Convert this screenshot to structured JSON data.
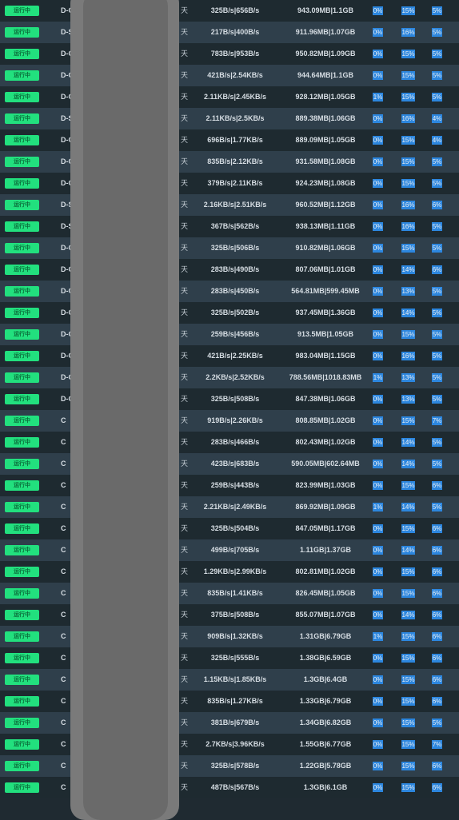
{
  "status_label": "运行中",
  "day_label": "天",
  "colors": {
    "status_green": "#22e07e",
    "percent_blue": "#2c86de",
    "row_dark": "#1e2a30",
    "row_light": "#2f3f4b"
  },
  "rows": [
    {
      "name": "D-C",
      "speed": "325B/s|656B/s",
      "traffic": "943.09MB|1.1GB",
      "cpu": "0%",
      "mem": "15%",
      "disk": "5%"
    },
    {
      "name": "D-S",
      "speed": "217B/s|400B/s",
      "traffic": "911.96MB|1.07GB",
      "cpu": "0%",
      "mem": "16%",
      "disk": "5%"
    },
    {
      "name": "D-C",
      "speed": "783B/s|953B/s",
      "traffic": "950.82MB|1.09GB",
      "cpu": "0%",
      "mem": "15%",
      "disk": "5%"
    },
    {
      "name": "D-C",
      "speed": "421B/s|2.54KB/s",
      "traffic": "944.64MB|1.1GB",
      "cpu": "0%",
      "mem": "15%",
      "disk": "5%"
    },
    {
      "name": "D-C",
      "speed": "2.11KB/s|2.45KB/s",
      "traffic": "928.12MB|1.05GB",
      "cpu": "1%",
      "mem": "15%",
      "disk": "5%"
    },
    {
      "name": "D-S",
      "speed": "2.11KB/s|2.5KB/s",
      "traffic": "889.38MB|1.06GB",
      "cpu": "0%",
      "mem": "16%",
      "disk": "4%"
    },
    {
      "name": "D-C",
      "speed": "696B/s|1.77KB/s",
      "traffic": "889.09MB|1.05GB",
      "cpu": "0%",
      "mem": "15%",
      "disk": "4%"
    },
    {
      "name": "D-C",
      "speed": "835B/s|2.12KB/s",
      "traffic": "931.58MB|1.08GB",
      "cpu": "0%",
      "mem": "15%",
      "disk": "5%"
    },
    {
      "name": "D-C",
      "speed": "379B/s|2.11KB/s",
      "traffic": "924.23MB|1.08GB",
      "cpu": "0%",
      "mem": "15%",
      "disk": "5%"
    },
    {
      "name": "D-S",
      "speed": "2.16KB/s|2.51KB/s",
      "traffic": "960.52MB|1.12GB",
      "cpu": "0%",
      "mem": "16%",
      "disk": "6%"
    },
    {
      "name": "D-S",
      "speed": "367B/s|562B/s",
      "traffic": "938.13MB|1.11GB",
      "cpu": "0%",
      "mem": "16%",
      "disk": "5%"
    },
    {
      "name": "D-C",
      "speed": "325B/s|506B/s",
      "traffic": "910.82MB|1.06GB",
      "cpu": "0%",
      "mem": "15%",
      "disk": "5%"
    },
    {
      "name": "D-C",
      "speed": "283B/s|490B/s",
      "traffic": "807.06MB|1.01GB",
      "cpu": "0%",
      "mem": "14%",
      "disk": "6%"
    },
    {
      "name": "D-C",
      "speed": "283B/s|450B/s",
      "traffic": "564.81MB|599.45MB",
      "cpu": "0%",
      "mem": "13%",
      "disk": "5%"
    },
    {
      "name": "D-C",
      "speed": "325B/s|502B/s",
      "traffic": "937.45MB|1.36GB",
      "cpu": "0%",
      "mem": "14%",
      "disk": "5%"
    },
    {
      "name": "D-C",
      "speed": "259B/s|456B/s",
      "traffic": "913.5MB|1.05GB",
      "cpu": "0%",
      "mem": "15%",
      "disk": "5%"
    },
    {
      "name": "D-C",
      "speed": "421B/s|2.25KB/s",
      "traffic": "983.04MB|1.15GB",
      "cpu": "0%",
      "mem": "16%",
      "disk": "5%"
    },
    {
      "name": "D-C",
      "speed": "2.2KB/s|2.52KB/s",
      "traffic": "788.56MB|1018.83MB",
      "cpu": "1%",
      "mem": "13%",
      "disk": "5%"
    },
    {
      "name": "D-C",
      "speed": "325B/s|508B/s",
      "traffic": "847.38MB|1.06GB",
      "cpu": "0%",
      "mem": "13%",
      "disk": "5%"
    },
    {
      "name": "C",
      "speed": "919B/s|2.26KB/s",
      "traffic": "808.85MB|1.02GB",
      "cpu": "0%",
      "mem": "15%",
      "disk": "7%"
    },
    {
      "name": "C",
      "speed": "283B/s|466B/s",
      "traffic": "802.43MB|1.02GB",
      "cpu": "0%",
      "mem": "14%",
      "disk": "5%"
    },
    {
      "name": "C",
      "speed": "423B/s|683B/s",
      "traffic": "590.05MB|602.64MB",
      "cpu": "0%",
      "mem": "14%",
      "disk": "5%"
    },
    {
      "name": "C",
      "speed": "259B/s|443B/s",
      "traffic": "823.99MB|1.03GB",
      "cpu": "0%",
      "mem": "15%",
      "disk": "6%"
    },
    {
      "name": "C",
      "speed": "2.21KB/s|2.49KB/s",
      "traffic": "869.92MB|1.09GB",
      "cpu": "1%",
      "mem": "14%",
      "disk": "5%"
    },
    {
      "name": "C",
      "speed": "325B/s|504B/s",
      "traffic": "847.05MB|1.17GB",
      "cpu": "0%",
      "mem": "15%",
      "disk": "6%"
    },
    {
      "name": "C",
      "speed": "499B/s|705B/s",
      "traffic": "1.11GB|1.37GB",
      "cpu": "0%",
      "mem": "14%",
      "disk": "6%"
    },
    {
      "name": "C",
      "speed": "1.29KB/s|2.99KB/s",
      "traffic": "802.81MB|1.02GB",
      "cpu": "0%",
      "mem": "15%",
      "disk": "6%"
    },
    {
      "name": "C",
      "speed": "835B/s|1.41KB/s",
      "traffic": "826.45MB|1.05GB",
      "cpu": "0%",
      "mem": "15%",
      "disk": "6%"
    },
    {
      "name": "C",
      "speed": "375B/s|508B/s",
      "traffic": "855.07MB|1.07GB",
      "cpu": "0%",
      "mem": "14%",
      "disk": "6%"
    },
    {
      "name": "C",
      "speed": "909B/s|1.32KB/s",
      "traffic": "1.31GB|6.79GB",
      "cpu": "1%",
      "mem": "15%",
      "disk": "6%"
    },
    {
      "name": "C",
      "speed": "325B/s|555B/s",
      "traffic": "1.38GB|6.59GB",
      "cpu": "0%",
      "mem": "15%",
      "disk": "6%"
    },
    {
      "name": "C",
      "speed": "1.15KB/s|1.85KB/s",
      "traffic": "1.3GB|6.4GB",
      "cpu": "0%",
      "mem": "15%",
      "disk": "6%"
    },
    {
      "name": "C",
      "speed": "835B/s|1.27KB/s",
      "traffic": "1.33GB|6.79GB",
      "cpu": "0%",
      "mem": "15%",
      "disk": "6%"
    },
    {
      "name": "C",
      "speed": "381B/s|679B/s",
      "traffic": "1.34GB|6.82GB",
      "cpu": "0%",
      "mem": "15%",
      "disk": "5%"
    },
    {
      "name": "C",
      "speed": "2.7KB/s|3.96KB/s",
      "traffic": "1.55GB|6.77GB",
      "cpu": "0%",
      "mem": "15%",
      "disk": "7%"
    },
    {
      "name": "C",
      "speed": "325B/s|578B/s",
      "traffic": "1.22GB|5.78GB",
      "cpu": "0%",
      "mem": "15%",
      "disk": "6%"
    },
    {
      "name": "C",
      "speed": "487B/s|567B/s",
      "traffic": "1.3GB|6.1GB",
      "cpu": "0%",
      "mem": "15%",
      "disk": "6%"
    }
  ]
}
